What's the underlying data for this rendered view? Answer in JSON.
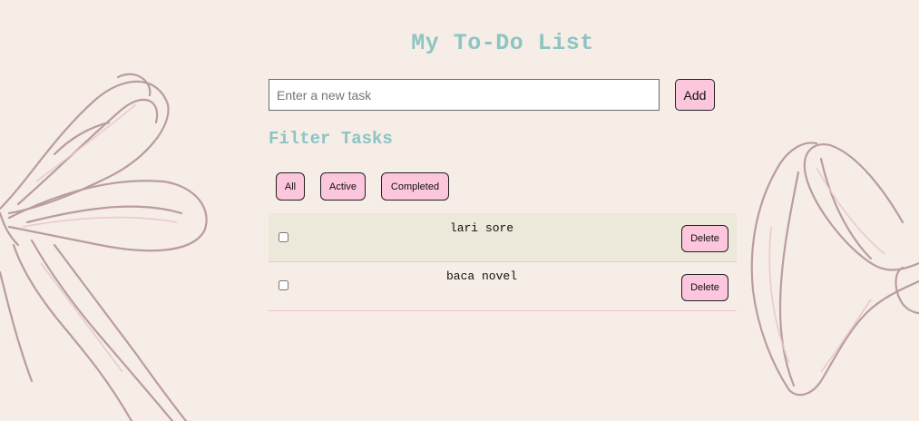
{
  "app": {
    "title": "My To-Do List"
  },
  "add_task": {
    "placeholder": "Enter a new task",
    "value": "",
    "button_label": "Add"
  },
  "filters": {
    "heading": "Filter Tasks",
    "buttons": [
      {
        "label": "All"
      },
      {
        "label": "Active"
      },
      {
        "label": "Completed"
      }
    ]
  },
  "tasks": [
    {
      "text": "lari sore",
      "completed": false,
      "delete_label": "Delete"
    },
    {
      "text": "baca novel",
      "completed": false,
      "delete_label": "Delete"
    }
  ],
  "colors": {
    "background": "#f5ede6",
    "heading": "#8dc4c4",
    "button": "#fcc6dd",
    "row_alt": "#ece8da",
    "row_border": "#f2c2cf",
    "ribbon_line": "#b08f94"
  }
}
